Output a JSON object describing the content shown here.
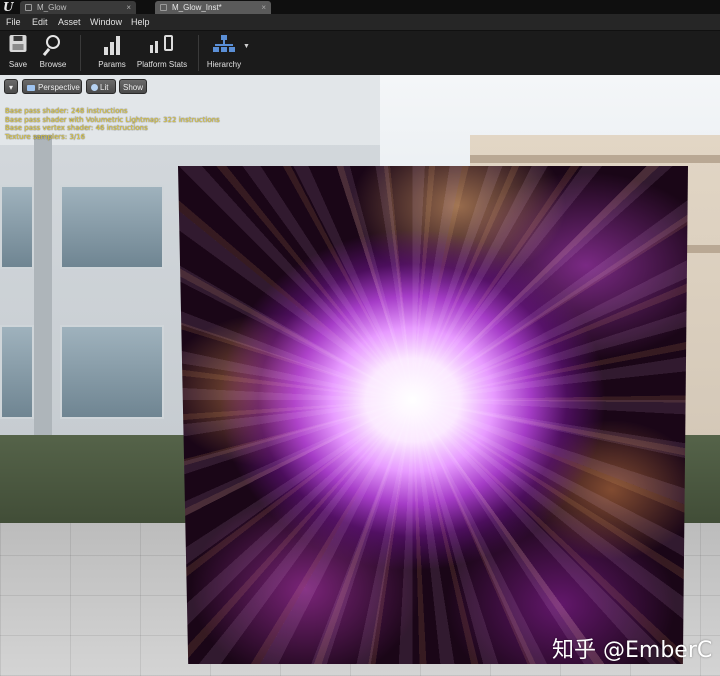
{
  "tabs": [
    {
      "label": "M_Glow",
      "active": false
    },
    {
      "label": "M_Glow_Inst*",
      "active": true
    }
  ],
  "menu": [
    "File",
    "Edit",
    "Asset",
    "Window",
    "Help"
  ],
  "toolbar": {
    "save_label": "Save",
    "browse_label": "Browse",
    "params_label": "Params",
    "platform_stats_label": "Platform Stats",
    "hierarchy_label": "Hierarchy"
  },
  "viewport": {
    "perspective_label": "Perspective",
    "lit_label": "Lit",
    "show_label": "Show",
    "stats": [
      "Base pass shader: 248 instructions",
      "Base pass shader with Volumetric Lightmap: 322 instructions",
      "Base pass vertex shader: 46 instructions",
      "Texture samplers: 3/16"
    ]
  },
  "watermark": "知乎 @EmberC",
  "colors": {
    "stats_text": "#e8d24a",
    "hierarchy_icon": "#5b8fd6",
    "glow_core": "#fbe8ff",
    "glow_purple": "#be46e6",
    "glow_orange": "#ffaa5a"
  }
}
